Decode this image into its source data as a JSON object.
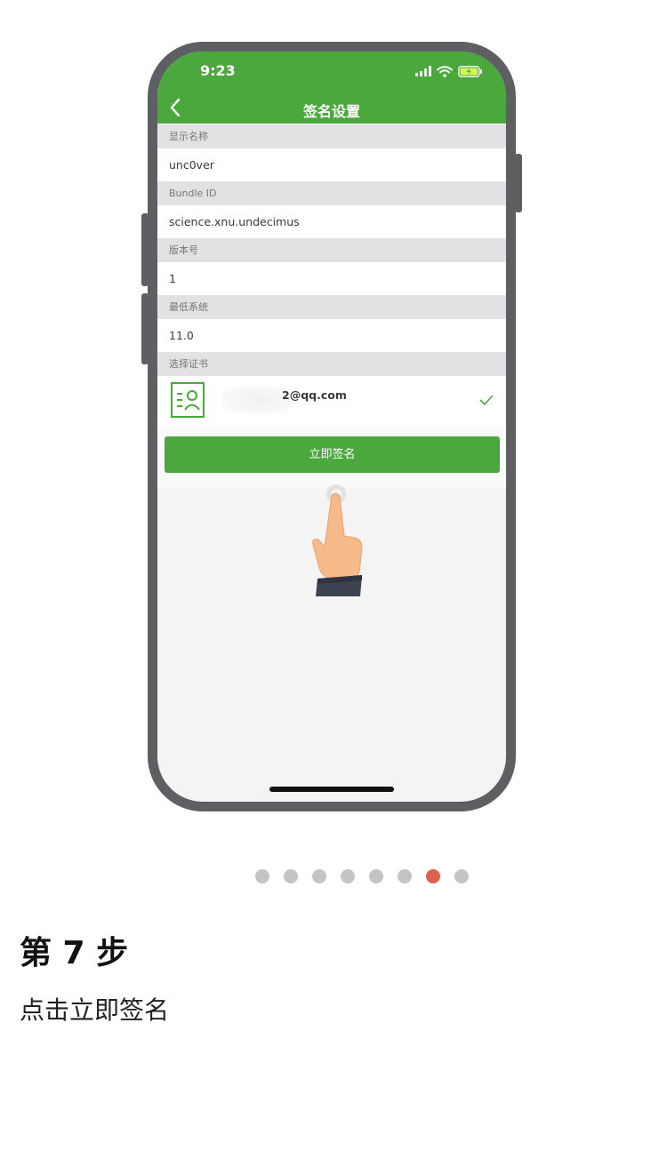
{
  "status_bar": {
    "time": "9:23"
  },
  "nav": {
    "title": "签名设置"
  },
  "form": {
    "sections": [
      {
        "label": "显示名称",
        "value": "unc0ver"
      },
      {
        "label": "Bundle ID",
        "value": "science.xnu.undecimus"
      },
      {
        "label": "版本号",
        "value": "1"
      },
      {
        "label": "最低系统",
        "value": "11.0"
      }
    ],
    "certificate": {
      "label": "选择证书",
      "email": "2@qq.com"
    }
  },
  "sign_button": {
    "label": "立即签名"
  },
  "pagination": {
    "total": 8,
    "active_index": 6
  },
  "step": {
    "title": "第 7 步",
    "description": "点击立即签名"
  },
  "colors": {
    "accent": "#4aa83d",
    "active_dot": "#e0604f",
    "inactive_dot": "#c4c4c4"
  },
  "icons": [
    "back-chevron-icon",
    "signal-icon",
    "wifi-icon",
    "battery-icon",
    "certificate-icon",
    "checkmark-icon",
    "pointing-hand-icon"
  ]
}
